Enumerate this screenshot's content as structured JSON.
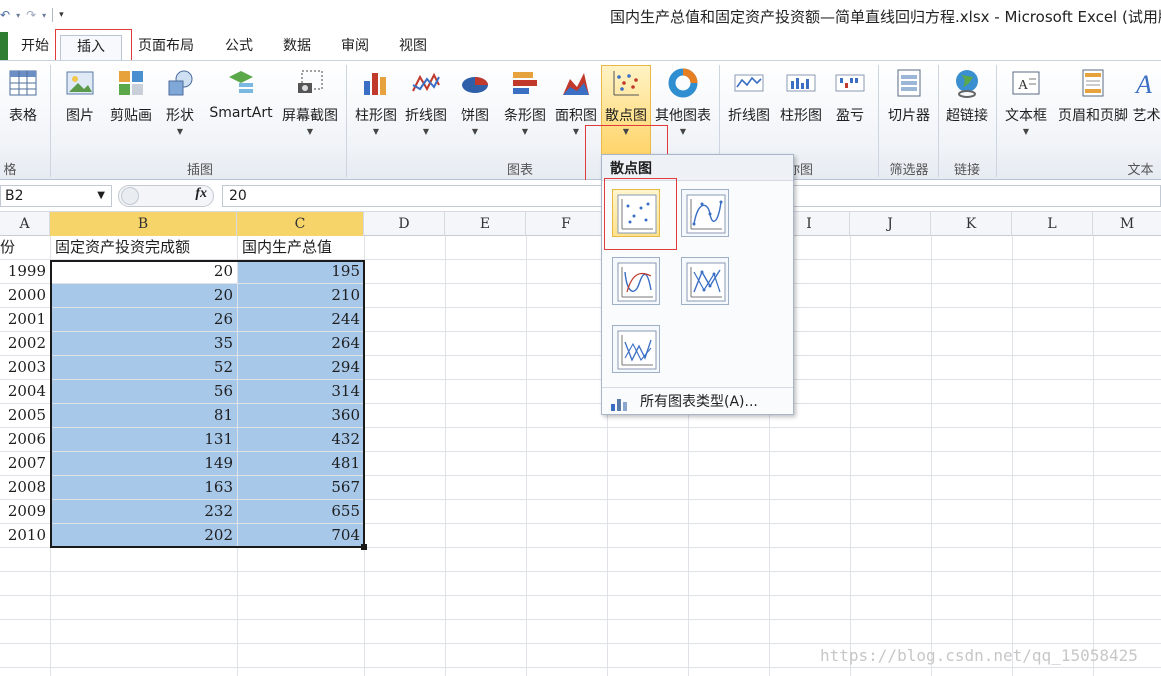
{
  "window": {
    "title": "国内生产总值和固定资产投资额—简单直线回归方程.xlsx - Microsoft Excel (试用版)",
    "qat": [
      "undo",
      "redo",
      "customize"
    ]
  },
  "tabs": [
    {
      "label": "开始"
    },
    {
      "label": "插入"
    },
    {
      "label": "页面布局"
    },
    {
      "label": "公式"
    },
    {
      "label": "数据"
    },
    {
      "label": "审阅"
    },
    {
      "label": "视图"
    }
  ],
  "ribbon": {
    "buttons": {
      "table": "表格",
      "picture": "图片",
      "clipart": "剪贴画",
      "shapes": "形状",
      "smartart": "SmartArt",
      "screenshot": "屏幕截图",
      "column_chart": "柱形图",
      "line_chart": "折线图",
      "pie_chart": "饼图",
      "bar_chart": "条形图",
      "area_chart": "面积图",
      "scatter_chart": "散点图",
      "other_chart": "其他图表",
      "spark_line": "折线图",
      "spark_column": "柱形图",
      "spark_winloss": "盈亏",
      "slicer": "切片器",
      "hyperlink": "超链接",
      "textbox": "文本框",
      "header_footer": "页眉和页脚",
      "wordart": "艺术"
    },
    "groups": {
      "tables_tail": "格",
      "illustrations": "插图",
      "charts": "图表",
      "sparklines_tail": "你图",
      "filter": "筛选器",
      "links": "链接",
      "text": "文本"
    }
  },
  "formula_bar": {
    "name_box": "B2",
    "fx": "fx",
    "value": "20"
  },
  "columns": [
    "A",
    "B",
    "C",
    "D",
    "E",
    "F",
    "G",
    "H",
    "I",
    "J",
    "K",
    "L",
    "M"
  ],
  "sheet": {
    "header_row": [
      "份",
      "固定资产投资完成额",
      "国内生产总值"
    ],
    "rows": [
      [
        "1999",
        "20",
        "195"
      ],
      [
        "2000",
        "20",
        "210"
      ],
      [
        "2001",
        "26",
        "244"
      ],
      [
        "2002",
        "35",
        "264"
      ],
      [
        "2003",
        "52",
        "294"
      ],
      [
        "2004",
        "56",
        "314"
      ],
      [
        "2005",
        "81",
        "360"
      ],
      [
        "2006",
        "131",
        "432"
      ],
      [
        "2007",
        "149",
        "481"
      ],
      [
        "2008",
        "163",
        "567"
      ],
      [
        "2009",
        "232",
        "655"
      ],
      [
        "2010",
        "202",
        "704"
      ]
    ]
  },
  "scatter_dropdown": {
    "header": "散点图",
    "items": [
      "markers-only",
      "smooth-lines-markers",
      "smooth-lines",
      "straight-lines-markers",
      "straight-lines"
    ],
    "footer": "所有图表类型(A)..."
  },
  "watermark": "https://blog.csdn.net/qq_15058425",
  "colors": {
    "selection_fill": "#a8c8ea",
    "highlight_column_header": "#f7d46a",
    "annotation_red": "#e03a3a"
  }
}
